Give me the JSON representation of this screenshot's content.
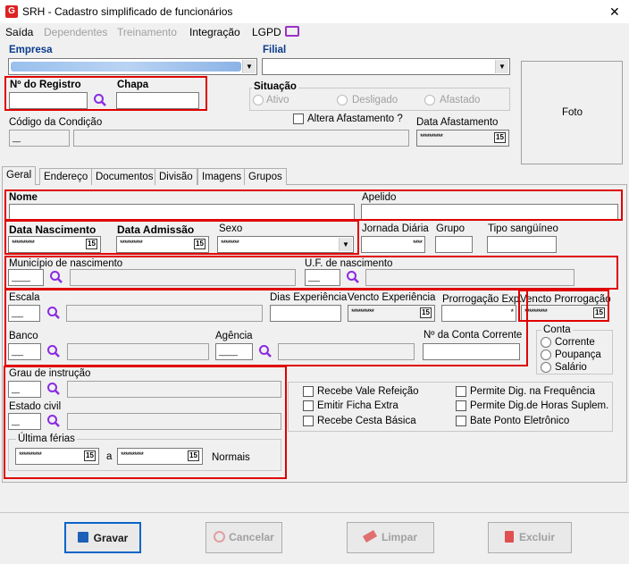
{
  "window": {
    "title": "SRH - Cadastro simplificado de funcionários",
    "close": "✕"
  },
  "menu": {
    "saida": "Saída",
    "dependentes": "Dependentes",
    "treinamento": "Treinamento",
    "integracao": "Integração",
    "lgpd": "LGPD"
  },
  "header": {
    "empresa_label": "Empresa",
    "filial_label": "Filial",
    "registro_label": "Nº do Registro",
    "chapa_label": "Chapa",
    "situacao_label": "Situação",
    "situacao_options": [
      "Ativo",
      "Desligado",
      "Afastado"
    ],
    "codigo_condicao_label": "Código da Condição",
    "codigo_condicao_value": "__",
    "altera_afastamento_label": "Altera Afastamento ?",
    "data_afastamento_label": "Data Afastamento",
    "data_afastamento_value": "**********",
    "foto_label": "Foto"
  },
  "tabs": [
    "Geral",
    "Endereço",
    "Documentos",
    "Divisão",
    "Imagens",
    "Grupos"
  ],
  "geral": {
    "nome_label": "Nome",
    "apelido_label": "Apelido",
    "data_nascimento_label": "Data Nascimento",
    "data_nascimento_value": "**********",
    "data_admissao_label": "Data Admissão",
    "data_admissao_value": "**********",
    "sexo_label": "Sexo",
    "sexo_value": "********",
    "jornada_label": "Jornada Diária",
    "jornada_value": "****",
    "grupo_label": "Grupo",
    "tipo_sanguineo_label": "Tipo sangüíneo",
    "municipio_label": "Município de nascimento",
    "municipio_value": "_____",
    "uf_label": "U.F. de nascimento",
    "uf_value": "___",
    "escala_label": "Escala",
    "escala_value": "___",
    "dias_experiencia_label": "Dias Experiência",
    "vencto_experiencia_label": "Vencto Experiência",
    "vencto_experiencia_value": "**********",
    "prorrogacao_label": "Prorrogação Exp.",
    "prorrogacao_value": "*",
    "vencto_prorrogacao_label": "Vencto Prorrogação",
    "vencto_prorrogacao_value": "**********",
    "banco_label": "Banco",
    "banco_value": "___",
    "agencia_label": "Agência",
    "agencia_value": "_____",
    "conta_corrente_label": "Nº da Conta Corrente",
    "conta_label": "Conta",
    "conta_options": [
      "Corrente",
      "Poupança",
      "Salário"
    ],
    "grau_label": "Grau de instrução",
    "grau_value": "__",
    "estado_civil_label": "Estado civil",
    "estado_civil_value": "__",
    "ultima_ferias_label": "Última férias",
    "ferias_inicio": "**********",
    "ferias_a": "a",
    "ferias_fim": "**********",
    "ferias_status": "Normais",
    "checks": [
      "Recebe Vale Refeição",
      "Emitir Ficha Extra",
      "Recebe Cesta Básica",
      "Permite Dig. na Frequência",
      "Permite Dig.de Horas Suplem.",
      "Bate Ponto Eletrônico"
    ]
  },
  "buttons": {
    "gravar": "Gravar",
    "cancelar": "Cancelar",
    "limpar": "Limpar",
    "excluir": "Excluir"
  },
  "calendar_glyph": "15",
  "colors": {
    "highlight": "#e00000",
    "primary_border": "#0a64c8",
    "lgpd_icon": "#9b30c8",
    "search_icon": "#8a2be2"
  }
}
